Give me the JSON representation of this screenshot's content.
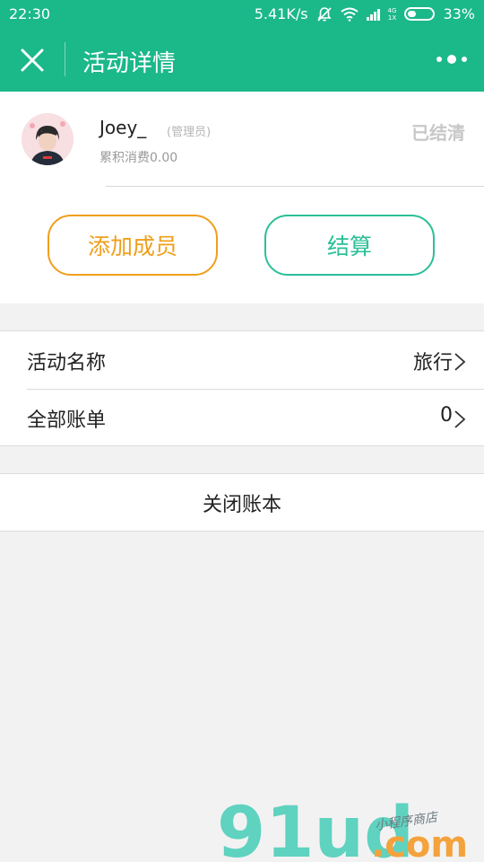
{
  "status_bar": {
    "time": "22:30",
    "net_speed": "5.41K/s",
    "net_type_top": "4G",
    "net_type_bottom": "1X",
    "battery": "33%",
    "battery_level": 0.33,
    "icons": [
      "bell-muted-icon",
      "wifi-icon",
      "signal-icon",
      "battery-icon"
    ]
  },
  "nav": {
    "title": "活动详情",
    "icons": [
      "close-icon",
      "more-icon"
    ]
  },
  "user": {
    "name": "Joey_",
    "role": "(管理员)",
    "total_spend": "累积消费0.00",
    "status": "已结清",
    "avatar_icon": "avatar"
  },
  "actions": {
    "add_member": "添加成员",
    "settle": "结算"
  },
  "list": {
    "rows": [
      {
        "label": "活动名称",
        "value": "旅行"
      },
      {
        "label": "全部账单",
        "value": "0"
      }
    ]
  },
  "close_book_label": "关闭账本",
  "watermark": {
    "brand": "91ud",
    "domain": ".com",
    "tagline": "小程序商店"
  },
  "colors": {
    "primary": "#1bb88a",
    "orange": "#ef9f1b",
    "green_button": "#2bbf98",
    "settled_text": "#c8c8c8",
    "background": "#f2f2f2"
  }
}
